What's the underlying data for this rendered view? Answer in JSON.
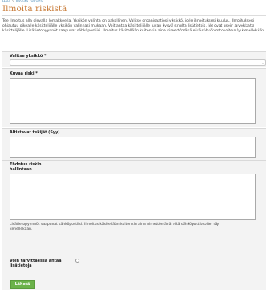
{
  "breadcrumb": {
    "home": "Hole",
    "separator": " > ",
    "current": "Ilmoita riskistä"
  },
  "page": {
    "title": "Ilmoita riskistä"
  },
  "intro": {
    "text": "Tee ilmoitus alla olevalla lomakkeella. Yksikön valinta on pakollinen. Valitse organisaatiosi yksikkö, jolle ilmoituksesi kuuluu. Ilmoituksesi ohjautuu oikealle käsittelijälle yksikön valinnasi mukaan. Voit antaa käsittelijälle luvan kysyä sinulta lisätietoja. Ne ovat usein arvokkaita käsittelijälle. Lisätietopyynnöt saapuvat sähköpostiisi. Ilmoitus käsitellään kuitenkin aina nimettömänä eikä sähköpostiosoite näy kenellekään."
  },
  "form": {
    "unit": {
      "label": "Valitse yksikkö *",
      "value": ""
    },
    "describe": {
      "label": "Kuvaa riski *",
      "value": ""
    },
    "factors": {
      "label": "Altistavat tekijät (Syy)",
      "value": ""
    },
    "proposal": {
      "label_line1": "Ehdotus riskin",
      "label_line2": "hallintaan",
      "value": ""
    },
    "note": "Lisätietopyynnöt saapuvat sähköpostiisi. Ilmoitus käsitellään kuitenkin aina nimettömänä eikä sähköpostiosoite näy kenellekään.",
    "contact": {
      "label_line1": "Voin tarvittaessa antaa",
      "label_line2": "lisätietoja"
    },
    "submit_label": "Lähetä"
  },
  "colors": {
    "title": "#c97c3a",
    "link": "#4a8bb8",
    "section_bg": "#f3f3f3",
    "submit_bg": "#6bb24a"
  },
  "icons": {
    "select": "chevron-down-icon",
    "resize": "resize-grip-icon"
  }
}
